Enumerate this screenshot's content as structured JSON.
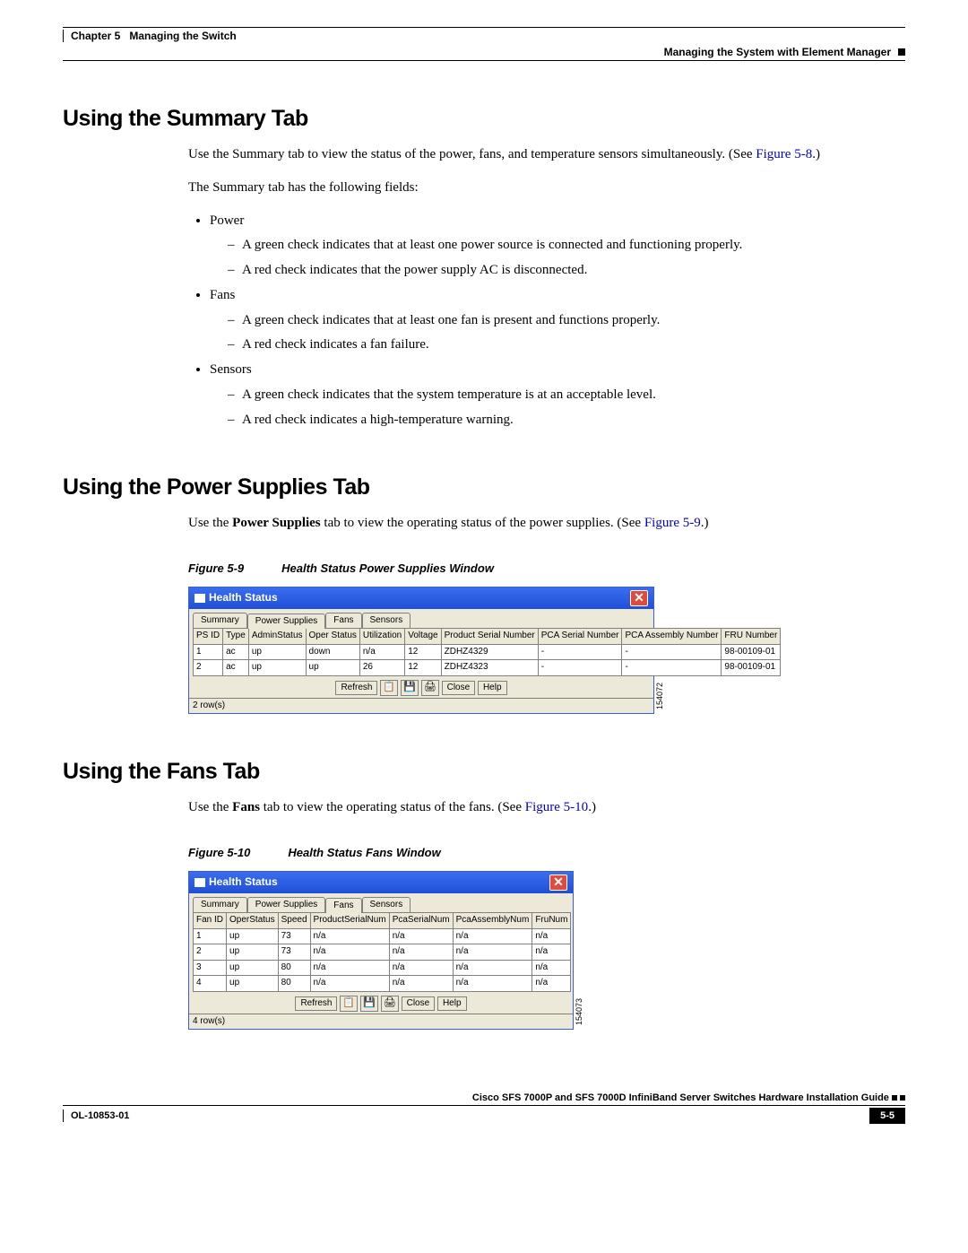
{
  "header": {
    "chapter_label": "Chapter 5",
    "chapter_title": "Managing the Switch",
    "subtitle": "Managing the System with Element Manager"
  },
  "sections": {
    "summary": {
      "heading": "Using the Summary Tab",
      "p1_pre": "Use the Summary tab to view the status of the power, fans, and temperature sensors simultaneously. (See ",
      "p1_ref": "Figure 5-8",
      "p1_post": ".)",
      "p2": "The Summary tab has the following fields:",
      "items": {
        "power_label": "Power",
        "power_sub1": "A green check indicates that at least one power source is connected and functioning properly.",
        "power_sub2": "A red check indicates that the power supply AC is disconnected.",
        "fans_label": "Fans",
        "fans_sub1": "A green check indicates that at least one fan is present and functions properly.",
        "fans_sub2": "A red check indicates a fan failure.",
        "sensors_label": "Sensors",
        "sensors_sub1": "A green check indicates that the system temperature is at an acceptable level.",
        "sensors_sub2": "A red check indicates a high-temperature warning."
      }
    },
    "power": {
      "heading": "Using the Power Supplies Tab",
      "p1_a": "Use the ",
      "p1_b": "Power Supplies",
      "p1_c": " tab to view the operating status of the power supplies. (See ",
      "p1_ref": "Figure 5-9",
      "p1_d": ".)",
      "fig_num": "Figure 5-9",
      "fig_title": "Health Status Power Supplies Window"
    },
    "fans": {
      "heading": "Using the Fans Tab",
      "p1_a": "Use the ",
      "p1_b": "Fans",
      "p1_c": " tab to view the operating status of the fans. (See ",
      "p1_ref": "Figure 5-10",
      "p1_d": ".)",
      "fig_num": "Figure 5-10",
      "fig_title": "Health Status Fans Window"
    }
  },
  "win_ps": {
    "title": "Health Status",
    "tabs": [
      "Summary",
      "Power Supplies",
      "Fans",
      "Sensors"
    ],
    "active_tab": 1,
    "columns": [
      "PS ID",
      "Type",
      "AdminStatus",
      "Oper Status",
      "Utilization",
      "Voltage",
      "Product Serial Number",
      "PCA Serial Number",
      "PCA Assembly Number",
      "FRU Number"
    ],
    "rows": [
      [
        "1",
        "ac",
        "up",
        "down",
        "n/a",
        "12",
        "ZDHZ4329",
        "-",
        "-",
        "98-00109-01"
      ],
      [
        "2",
        "ac",
        "up",
        "up",
        "26",
        "12",
        "ZDHZ4323",
        "-",
        "-",
        "98-00109-01"
      ]
    ],
    "buttons": {
      "refresh": "Refresh",
      "close": "Close",
      "help": "Help"
    },
    "status": "2 row(s)",
    "sideid": "154072"
  },
  "win_fans": {
    "title": "Health Status",
    "tabs": [
      "Summary",
      "Power Supplies",
      "Fans",
      "Sensors"
    ],
    "active_tab": 2,
    "columns": [
      "Fan ID",
      "OperStatus",
      "Speed",
      "ProductSerialNum",
      "PcaSerialNum",
      "PcaAssemblyNum",
      "FruNum"
    ],
    "rows": [
      [
        "1",
        "up",
        "73",
        "n/a",
        "n/a",
        "n/a",
        "n/a"
      ],
      [
        "2",
        "up",
        "73",
        "n/a",
        "n/a",
        "n/a",
        "n/a"
      ],
      [
        "3",
        "up",
        "80",
        "n/a",
        "n/a",
        "n/a",
        "n/a"
      ],
      [
        "4",
        "up",
        "80",
        "n/a",
        "n/a",
        "n/a",
        "n/a"
      ]
    ],
    "buttons": {
      "refresh": "Refresh",
      "close": "Close",
      "help": "Help"
    },
    "status": "4 row(s)",
    "sideid": "154073"
  },
  "footer": {
    "guide": "Cisco SFS 7000P and SFS 7000D InfiniBand Server Switches Hardware Installation Guide",
    "doc_id": "OL-10853-01",
    "page": "5-5"
  }
}
